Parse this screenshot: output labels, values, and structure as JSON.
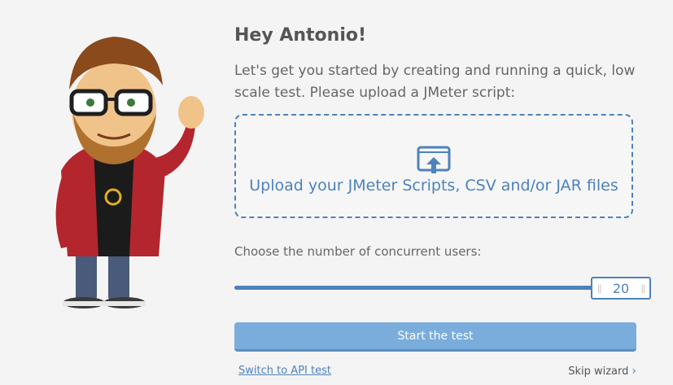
{
  "greeting": "Hey Antonio!",
  "intro": "Let's get you started by creating and running a quick, low scale test. Please upload a JMeter script:",
  "upload": {
    "icon": "upload-icon",
    "label": "Upload your JMeter Scripts, CSV and/or JAR files"
  },
  "users": {
    "label": "Choose the number of concurrent users:",
    "value": "20",
    "fraction": 1.0
  },
  "start_button": "Start the test",
  "footer": {
    "api_link": "Switch to API test",
    "skip": "Skip wizard"
  },
  "colors": {
    "accent": "#4d82bd",
    "button": "#7aaddc",
    "background": "#f4f4f4"
  }
}
